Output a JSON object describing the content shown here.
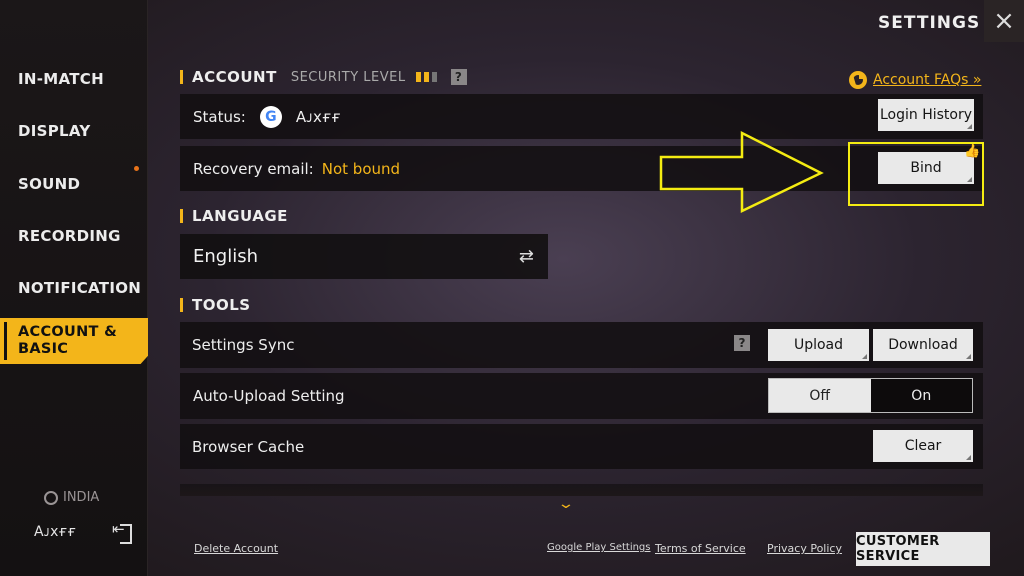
{
  "header": {
    "title": "SETTINGS",
    "close_icon": "×"
  },
  "sidebar": {
    "items": [
      {
        "label": "IN-MATCH"
      },
      {
        "label": "DISPLAY"
      },
      {
        "label": "SOUND"
      },
      {
        "label": "RECORDING"
      },
      {
        "label": "NOTIFICATION"
      },
      {
        "label": "ACCOUNT & BASIC",
        "active": true
      }
    ],
    "region": "INDIA",
    "username": "Aᴊxғғ"
  },
  "account": {
    "heading": "ACCOUNT",
    "security_label": "SECURITY LEVEL",
    "faq_link": "Account FAQs »",
    "status_label": "Status:",
    "status_account": "Aᴊxғғ",
    "login_history": "Login History",
    "recovery_label": "Recovery email:",
    "recovery_value": "Not bound",
    "bind_label": "Bind"
  },
  "language": {
    "heading": "LANGUAGE",
    "current": "English",
    "swap_icon": "⇄"
  },
  "tools": {
    "heading": "TOOLS",
    "sync_label": "Settings Sync",
    "upload": "Upload",
    "download": "Download",
    "auto_upload_label": "Auto-Upload Setting",
    "toggle_off": "Off",
    "toggle_on": "On",
    "cache_label": "Browser Cache",
    "clear": "Clear"
  },
  "footer": {
    "delete_account": "Delete Account",
    "google_play_settings": "Google Play Settings",
    "terms": "Terms of Service",
    "privacy": "Privacy Policy",
    "customer_service": "CUSTOMER SERVICE"
  },
  "colors": {
    "accent": "#f3b51a",
    "annotation": "#f4ec12"
  }
}
